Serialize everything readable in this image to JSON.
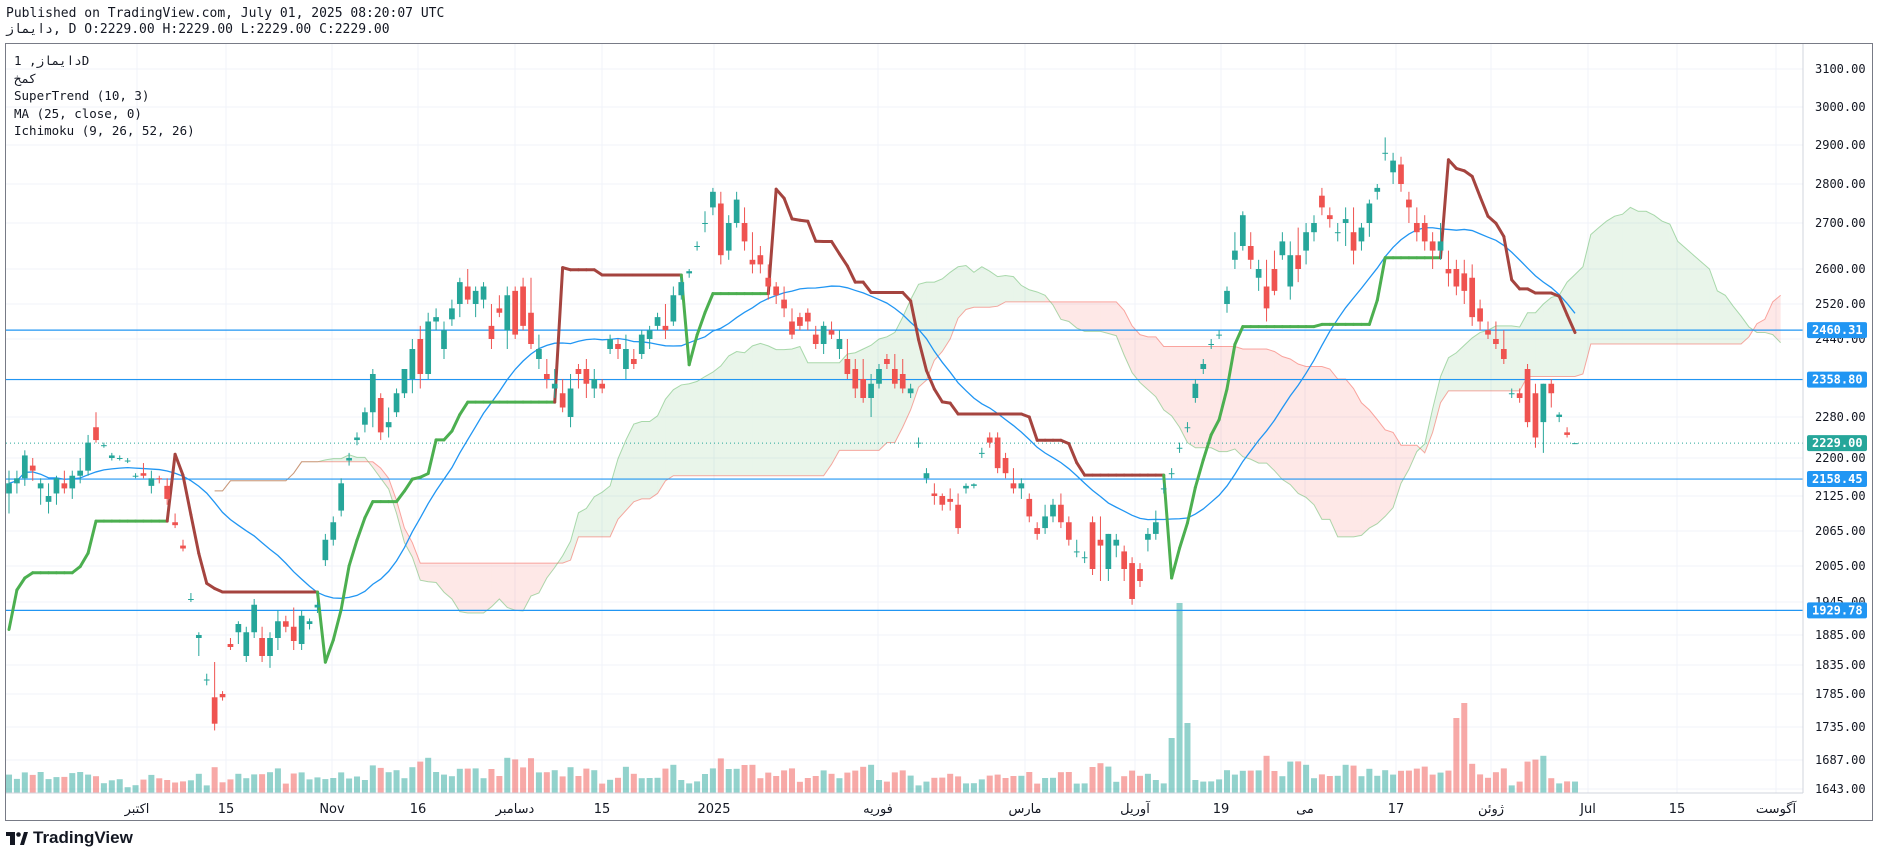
{
  "header": {
    "published": "Published on TradingView.com, July 01, 2025 08:20:07 UTC",
    "ohlc": "دایماز, D O:2229.00 H:2229.00 L:2229.00 C:2229.00"
  },
  "legend": {
    "symbol": "دایماز, 1D",
    "name": "کمخ",
    "supertrend": "SuperTrend (10, 3)",
    "ma": "MA (25, close, 0)",
    "ichimoku": "Ichimoku (9, 26, 52, 26)"
  },
  "brand": "TradingView",
  "colors": {
    "up": "#26a69a",
    "down": "#ef5350",
    "supertrend_up": "#4caf50",
    "supertrend_down": "#a5443f",
    "ma": "#2196f3",
    "hline": "#2196f3",
    "cloud_bull": "#4caf50",
    "cloud_bear": "#f44336"
  },
  "chart_data": {
    "type": "candlestick",
    "y_ticks": [
      3100,
      3000,
      2900,
      2800,
      2700,
      2600,
      2520,
      2440,
      2360,
      2280,
      2200,
      2125,
      2065,
      2005,
      1945,
      1885,
      1835,
      1785,
      1735,
      1687,
      1643
    ],
    "y_tick_labels": [
      "3100.00",
      "3000.00",
      "2900.00",
      "2800.00",
      "2700.00",
      "2600.00",
      "2520.00",
      "2440.00",
      "2360.00",
      "2280.00",
      "2200.00",
      "2125.00",
      "2065.00",
      "2005.00",
      "1945.00",
      "1885.00",
      "1835.00",
      "1785.00",
      "1735.00",
      "1687.00",
      "1643.00"
    ],
    "x_ticks": [
      "اکتبر",
      "15",
      "Nov",
      "16",
      "دسامبر",
      "15",
      "2025",
      "فوریه",
      "مارس",
      "آوریل",
      "19",
      "می",
      "17",
      "ژوئن",
      "Jul",
      "15",
      "آگوست"
    ],
    "price_lines": [
      {
        "value": 2460.31,
        "label": "2460.31"
      },
      {
        "value": 2358.8,
        "label": "2358.80"
      },
      {
        "value": 2158.45,
        "label": "2158.45"
      },
      {
        "value": 1929.78,
        "label": "1929.78"
      }
    ],
    "last_price": {
      "value": 2229.0,
      "label": "2229.00"
    },
    "candles": [
      [
        2130,
        2175,
        2095,
        2150
      ],
      [
        2150,
        2175,
        2130,
        2160
      ],
      [
        2160,
        2215,
        2145,
        2205
      ],
      [
        2185,
        2200,
        2155,
        2175
      ],
      [
        2140,
        2160,
        2110,
        2150
      ],
      [
        2115,
        2150,
        2095,
        2125
      ],
      [
        2130,
        2165,
        2110,
        2160
      ],
      [
        2150,
        2175,
        2130,
        2140
      ],
      [
        2140,
        2175,
        2120,
        2165
      ],
      [
        2165,
        2200,
        2150,
        2175
      ],
      [
        2175,
        2245,
        2165,
        2230
      ],
      [
        2260,
        2290,
        2230,
        2235
      ],
      [
        2225,
        2230,
        2220,
        2225
      ],
      [
        2200,
        2210,
        2195,
        2205
      ],
      [
        2200,
        2205,
        2195,
        2200
      ],
      [
        2195,
        2200,
        2190,
        2195
      ],
      [
        2165,
        2170,
        2160,
        2165
      ],
      [
        2170,
        2190,
        2160,
        2165
      ],
      [
        2145,
        2175,
        2130,
        2160
      ],
      [
        2160,
        2165,
        2150,
        2158
      ],
      [
        2145,
        2160,
        2110,
        2120
      ],
      [
        2080,
        2095,
        2070,
        2075
      ],
      [
        2040,
        2050,
        2030,
        2035
      ],
      [
        1950,
        1960,
        1945,
        1950
      ],
      [
        1880,
        1890,
        1850,
        1885
      ],
      [
        1810,
        1820,
        1800,
        1810
      ],
      [
        1780,
        1840,
        1730,
        1740
      ],
      [
        1785,
        1790,
        1775,
        1780
      ],
      [
        1870,
        1880,
        1860,
        1865
      ],
      [
        1890,
        1910,
        1870,
        1905
      ],
      [
        1850,
        1900,
        1840,
        1890
      ],
      [
        1890,
        1950,
        1880,
        1940
      ],
      [
        1880,
        1900,
        1840,
        1850
      ],
      [
        1850,
        1890,
        1830,
        1880
      ],
      [
        1880,
        1930,
        1860,
        1910
      ],
      [
        1910,
        1920,
        1890,
        1900
      ],
      [
        1900,
        1935,
        1860,
        1875
      ],
      [
        1870,
        1930,
        1860,
        1920
      ],
      [
        1905,
        1915,
        1895,
        1910
      ],
      [
        1935,
        1945,
        1925,
        1940
      ],
      [
        2015,
        2060,
        2005,
        2050
      ],
      [
        2050,
        2090,
        2040,
        2080
      ],
      [
        2100,
        2160,
        2090,
        2150
      ],
      [
        2195,
        2210,
        2185,
        2200
      ],
      [
        2235,
        2250,
        2225,
        2240
      ],
      [
        2265,
        2300,
        2250,
        2290
      ],
      [
        2290,
        2380,
        2260,
        2370
      ],
      [
        2320,
        2330,
        2235,
        2250
      ],
      [
        2260,
        2300,
        2240,
        2270
      ],
      [
        2290,
        2340,
        2280,
        2330
      ],
      [
        2330,
        2380,
        2320,
        2380
      ],
      [
        2360,
        2440,
        2330,
        2420
      ],
      [
        2440,
        2470,
        2340,
        2370
      ],
      [
        2370,
        2500,
        2360,
        2480
      ],
      [
        2480,
        2510,
        2460,
        2490
      ],
      [
        2420,
        2480,
        2400,
        2460
      ],
      [
        2485,
        2530,
        2470,
        2510
      ],
      [
        2520,
        2580,
        2490,
        2570
      ],
      [
        2560,
        2600,
        2520,
        2530
      ],
      [
        2520,
        2560,
        2490,
        2550
      ],
      [
        2530,
        2570,
        2510,
        2560
      ],
      [
        2470,
        2520,
        2420,
        2440
      ],
      [
        2510,
        2540,
        2490,
        2500
      ],
      [
        2460,
        2560,
        2420,
        2540
      ],
      [
        2550,
        2560,
        2440,
        2450
      ],
      [
        2560,
        2580,
        2460,
        2470
      ],
      [
        2500,
        2580,
        2420,
        2430
      ],
      [
        2400,
        2450,
        2380,
        2420
      ],
      [
        2370,
        2400,
        2340,
        2360
      ],
      [
        2340,
        2380,
        2320,
        2350
      ],
      [
        2330,
        2360,
        2290,
        2300
      ],
      [
        2280,
        2370,
        2260,
        2340
      ],
      [
        2380,
        2390,
        2340,
        2370
      ],
      [
        2380,
        2400,
        2320,
        2350
      ],
      [
        2340,
        2380,
        2320,
        2360
      ],
      [
        2350,
        2360,
        2330,
        2340
      ],
      [
        2420,
        2450,
        2410,
        2440
      ],
      [
        2430,
        2440,
        2400,
        2420
      ],
      [
        2380,
        2450,
        2360,
        2420
      ],
      [
        2400,
        2420,
        2380,
        2390
      ],
      [
        2410,
        2460,
        2400,
        2450
      ],
      [
        2440,
        2470,
        2420,
        2460
      ],
      [
        2470,
        2500,
        2460,
        2490
      ],
      [
        2470,
        2520,
        2440,
        2460
      ],
      [
        2480,
        2560,
        2470,
        2540
      ],
      [
        2540,
        2580,
        2530,
        2570
      ],
      [
        2590,
        2600,
        2580,
        2595
      ],
      [
        2650,
        2660,
        2640,
        2650
      ],
      [
        2700,
        2730,
        2680,
        2700
      ],
      [
        2740,
        2790,
        2720,
        2780
      ],
      [
        2750,
        2780,
        2610,
        2630
      ],
      [
        2640,
        2720,
        2620,
        2700
      ],
      [
        2700,
        2780,
        2690,
        2760
      ],
      [
        2700,
        2740,
        2640,
        2660
      ],
      [
        2620,
        2680,
        2590,
        2610
      ],
      [
        2630,
        2650,
        2590,
        2610
      ],
      [
        2580,
        2610,
        2530,
        2560
      ],
      [
        2560,
        2570,
        2520,
        2540
      ],
      [
        2530,
        2560,
        2490,
        2510
      ],
      [
        2480,
        2510,
        2440,
        2450
      ],
      [
        2490,
        2500,
        2460,
        2470
      ],
      [
        2500,
        2510,
        2460,
        2480
      ],
      [
        2450,
        2470,
        2420,
        2430
      ],
      [
        2430,
        2480,
        2410,
        2470
      ],
      [
        2460,
        2480,
        2440,
        2450
      ],
      [
        2420,
        2460,
        2400,
        2440
      ],
      [
        2400,
        2440,
        2360,
        2370
      ],
      [
        2380,
        2400,
        2320,
        2340
      ],
      [
        2360,
        2400,
        2310,
        2320
      ],
      [
        2320,
        2370,
        2280,
        2350
      ],
      [
        2350,
        2390,
        2340,
        2380
      ],
      [
        2400,
        2410,
        2380,
        2390
      ],
      [
        2380,
        2410,
        2340,
        2350
      ],
      [
        2370,
        2400,
        2330,
        2340
      ],
      [
        2330,
        2350,
        2320,
        2340
      ],
      [
        2230,
        2240,
        2220,
        2230
      ],
      [
        2160,
        2180,
        2150,
        2170
      ],
      [
        2130,
        2150,
        2110,
        2125
      ],
      [
        2125,
        2130,
        2100,
        2110
      ],
      [
        2120,
        2140,
        2100,
        2115
      ],
      [
        2110,
        2130,
        2060,
        2070
      ],
      [
        2140,
        2150,
        2130,
        2145
      ],
      [
        2145,
        2150,
        2140,
        2148
      ],
      [
        2210,
        2220,
        2200,
        2210
      ],
      [
        2240,
        2250,
        2220,
        2230
      ],
      [
        2240,
        2250,
        2170,
        2180
      ],
      [
        2200,
        2210,
        2160,
        2170
      ],
      [
        2150,
        2180,
        2130,
        2140
      ],
      [
        2140,
        2160,
        2120,
        2150
      ],
      [
        2120,
        2130,
        2080,
        2090
      ],
      [
        2070,
        2080,
        2050,
        2060
      ],
      [
        2070,
        2110,
        2060,
        2090
      ],
      [
        2090,
        2120,
        2080,
        2110
      ],
      [
        2110,
        2130,
        2070,
        2080
      ],
      [
        2080,
        2090,
        2040,
        2050
      ],
      [
        2030,
        2050,
        2020,
        2030
      ],
      [
        2020,
        2030,
        2010,
        2020
      ],
      [
        2080,
        2090,
        1990,
        2000
      ],
      [
        2050,
        2090,
        1980,
        2040
      ],
      [
        2000,
        2060,
        1980,
        2060
      ],
      [
        2040,
        2060,
        2020,
        2050
      ],
      [
        2030,
        2040,
        1980,
        2000
      ],
      [
        2010,
        2020,
        1940,
        1950
      ],
      [
        2000,
        2010,
        1970,
        1980
      ],
      [
        2050,
        2070,
        2030,
        2060
      ],
      [
        2060,
        2100,
        2050,
        2080
      ],
      [
        2140,
        2150,
        2130,
        2140
      ],
      [
        2170,
        2180,
        2160,
        2170
      ],
      [
        2220,
        2230,
        2210,
        2220
      ],
      [
        2260,
        2270,
        2250,
        2260
      ],
      [
        2320,
        2360,
        2310,
        2350
      ],
      [
        2380,
        2400,
        2370,
        2390
      ],
      [
        2430,
        2440,
        2420,
        2430
      ],
      [
        2450,
        2460,
        2440,
        2450
      ],
      [
        2520,
        2560,
        2500,
        2550
      ],
      [
        2620,
        2680,
        2600,
        2640
      ],
      [
        2650,
        2730,
        2640,
        2720
      ],
      [
        2650,
        2680,
        2600,
        2620
      ],
      [
        2580,
        2620,
        2550,
        2600
      ],
      [
        2560,
        2620,
        2480,
        2510
      ],
      [
        2600,
        2640,
        2540,
        2550
      ],
      [
        2630,
        2680,
        2620,
        2660
      ],
      [
        2560,
        2660,
        2530,
        2630
      ],
      [
        2630,
        2690,
        2570,
        2600
      ],
      [
        2640,
        2700,
        2610,
        2680
      ],
      [
        2680,
        2720,
        2660,
        2700
      ],
      [
        2770,
        2790,
        2720,
        2740
      ],
      [
        2720,
        2740,
        2690,
        2710
      ],
      [
        2680,
        2700,
        2660,
        2680
      ],
      [
        2700,
        2740,
        2650,
        2710
      ],
      [
        2680,
        2740,
        2610,
        2640
      ],
      [
        2660,
        2700,
        2640,
        2690
      ],
      [
        2700,
        2760,
        2670,
        2750
      ],
      [
        2780,
        2800,
        2760,
        2790
      ],
      [
        2880,
        2920,
        2860,
        2880
      ],
      [
        2830,
        2880,
        2800,
        2860
      ],
      [
        2850,
        2870,
        2780,
        2800
      ],
      [
        2760,
        2780,
        2700,
        2740
      ],
      [
        2700,
        2740,
        2660,
        2680
      ],
      [
        2700,
        2720,
        2640,
        2660
      ],
      [
        2660,
        2680,
        2600,
        2640
      ],
      [
        2640,
        2700,
        2620,
        2660
      ],
      [
        2600,
        2640,
        2560,
        2590
      ],
      [
        2600,
        2620,
        2540,
        2560
      ],
      [
        2590,
        2620,
        2520,
        2550
      ],
      [
        2580,
        2610,
        2470,
        2490
      ],
      [
        2510,
        2530,
        2460,
        2480
      ],
      [
        2460,
        2480,
        2440,
        2450
      ],
      [
        2440,
        2480,
        2420,
        2430
      ],
      [
        2420,
        2460,
        2390,
        2400
      ],
      [
        2330,
        2340,
        2320,
        2330
      ],
      [
        2330,
        2340,
        2310,
        2320
      ],
      [
        2380,
        2390,
        2260,
        2270
      ],
      [
        2330,
        2350,
        2220,
        2240
      ],
      [
        2270,
        2350,
        2210,
        2350
      ],
      [
        2350,
        2360,
        2300,
        2330
      ],
      [
        2280,
        2290,
        2270,
        2285
      ],
      [
        2250,
        2260,
        2240,
        2245
      ],
      [
        2229,
        2229,
        2229,
        2229
      ]
    ]
  }
}
